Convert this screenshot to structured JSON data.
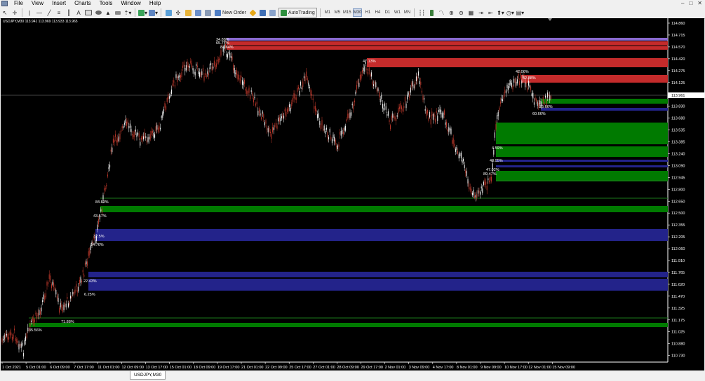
{
  "menu": [
    "File",
    "View",
    "Insert",
    "Charts",
    "Tools",
    "Window",
    "Help"
  ],
  "window_controls": [
    "–",
    "□",
    "✕"
  ],
  "toolbar": {
    "new_order_label": "New Order",
    "autotrading_label": "AutoTrading",
    "timeframes": [
      "M1",
      "M5",
      "M15",
      "M30",
      "H1",
      "H4",
      "D1",
      "W1",
      "MN"
    ],
    "active_timeframe": "M30"
  },
  "chart": {
    "header": "USDJPY,M30  113.941 113.969 113.933 113.965",
    "current_price_label": "113.961",
    "price_axis": [
      "114.860",
      "114.715",
      "114.570",
      "114.420",
      "114.275",
      "114.125",
      "113.980",
      "113.830",
      "113.680",
      "113.535",
      "113.385",
      "113.240",
      "113.090",
      "112.945",
      "112.800",
      "112.650",
      "112.500",
      "112.355",
      "112.205",
      "112.060",
      "111.910",
      "111.765",
      "111.620",
      "111.470",
      "111.325",
      "111.175",
      "111.025",
      "110.880",
      "110.730"
    ],
    "time_axis": [
      "1 Oct 2021",
      "5 Oct 01:00",
      "6 Oct 09:00",
      "7 Oct 17:00",
      "11 Oct 01:00",
      "12 Oct 09:00",
      "13 Oct 17:00",
      "15 Oct 01:00",
      "18 Oct 09:00",
      "19 Oct 17:00",
      "21 Oct 01:00",
      "22 Oct 09:00",
      "25 Oct 17:00",
      "27 Oct 01:00",
      "28 Oct 09:00",
      "29 Oct 17:00",
      "2 Nov 01:00",
      "3 Nov 09:00",
      "4 Nov 17:00",
      "8 Nov 01:00",
      "9 Nov 09:00",
      "10 Nov 17:00",
      "12 Nov 01:00",
      "15 Nov 09:00"
    ],
    "level_labels": [
      "34.88%",
      "65.77%",
      "84.64%",
      "47.13%",
      "42.06%",
      "42.88%",
      "25.66%",
      "60.66%",
      "4.59%",
      "48.05%",
      "47.02%",
      "89.47%",
      "84.63%",
      "43.57%",
      "32.5%",
      "14.76%",
      "22.43%",
      "6.25%",
      "71.88%",
      "35.56%"
    ],
    "colors": {
      "bg": "#000000",
      "bull": "#ffffff",
      "bear": "#c0392b",
      "green_zone": "#007a00",
      "red_zone": "#c42b2b",
      "blue_zone": "#23238a",
      "purple_zone": "#8a6ad0"
    }
  },
  "tab": {
    "label": "USDJPY,M30"
  }
}
